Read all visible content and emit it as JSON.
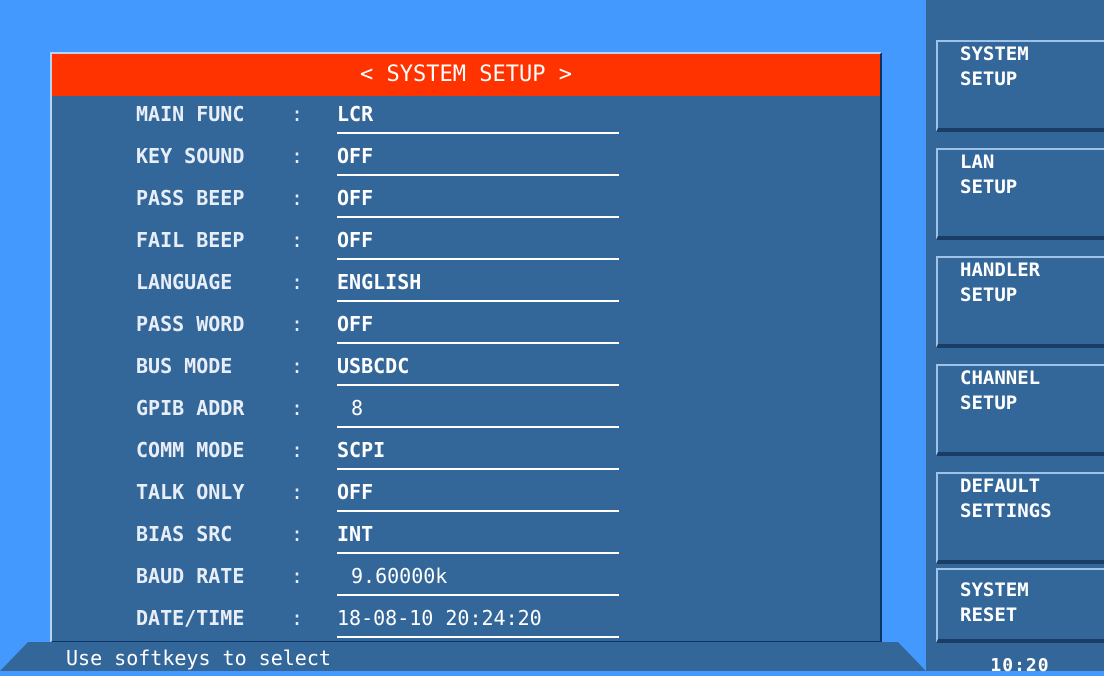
{
  "title": "< SYSTEM SETUP >",
  "rows": [
    {
      "label": "MAIN FUNC",
      "value": "LCR"
    },
    {
      "label": "KEY SOUND",
      "value": "OFF"
    },
    {
      "label": "PASS BEEP",
      "value": "OFF"
    },
    {
      "label": "FAIL BEEP",
      "value": "OFF"
    },
    {
      "label": "LANGUAGE",
      "value": "ENGLISH"
    },
    {
      "label": "PASS WORD",
      "value": "OFF"
    },
    {
      "label": "BUS MODE",
      "value": "USBCDC"
    },
    {
      "label": "GPIB ADDR",
      "value": "8"
    },
    {
      "label": "COMM MODE",
      "value": "SCPI"
    },
    {
      "label": "TALK ONLY",
      "value": "OFF"
    },
    {
      "label": "BIAS SRC",
      "value": "INT"
    },
    {
      "label": "BAUD RATE",
      "value": "9.60000k"
    },
    {
      "label": "DATE/TIME",
      "value": "18-08-10 20:24:20"
    }
  ],
  "colon": ":",
  "status": "Use softkeys to select",
  "softkeys": [
    {
      "line1": "SYSTEM",
      "line2": "SETUP"
    },
    {
      "line1": "LAN",
      "line2": "SETUP"
    },
    {
      "line1": "HANDLER",
      "line2": "SETUP"
    },
    {
      "line1": "CHANNEL",
      "line2": "SETUP"
    },
    {
      "line1": "DEFAULT",
      "line2": "SETTINGS"
    },
    {
      "line1": "SYSTEM",
      "line2": "RESET"
    }
  ],
  "clock": "10:20",
  "colors": {
    "background": "#4499ff",
    "panel": "#336699",
    "title_bar": "#ff3300",
    "text": "#ffffff"
  }
}
